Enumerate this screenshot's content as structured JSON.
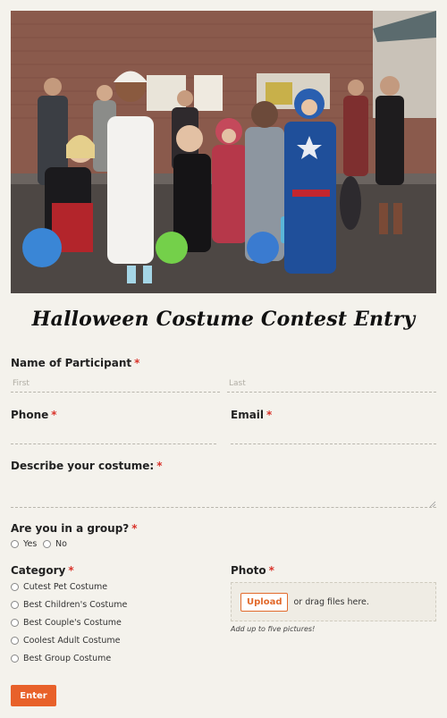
{
  "form": {
    "title": "Halloween Costume Contest Entry",
    "required_marker": "*",
    "name": {
      "label": "Name of Participant",
      "first_placeholder": "First",
      "last_placeholder": "Last"
    },
    "phone": {
      "label": "Phone",
      "value": ""
    },
    "email": {
      "label": "Email",
      "value": ""
    },
    "costume": {
      "label": "Describe your costume:",
      "value": ""
    },
    "group": {
      "label": "Are you in a group?",
      "options": [
        "Yes",
        "No"
      ]
    },
    "category": {
      "label": "Category",
      "options": [
        "Cutest Pet Costume",
        "Best Children's Costume",
        "Best Couple's Costume",
        "Coolest Adult Costume",
        "Best Group Costume"
      ]
    },
    "photo": {
      "label": "Photo",
      "upload_button": "Upload",
      "drag_hint": "or drag files here.",
      "note": "Add up to five pictures!"
    },
    "submit_label": "Enter"
  },
  "colors": {
    "background": "#f4f2ec",
    "accent": "#e8612a",
    "required": "#d9342b"
  },
  "hero_image": {
    "alt": "Children in Halloween costumes",
    "icon": "photo"
  }
}
